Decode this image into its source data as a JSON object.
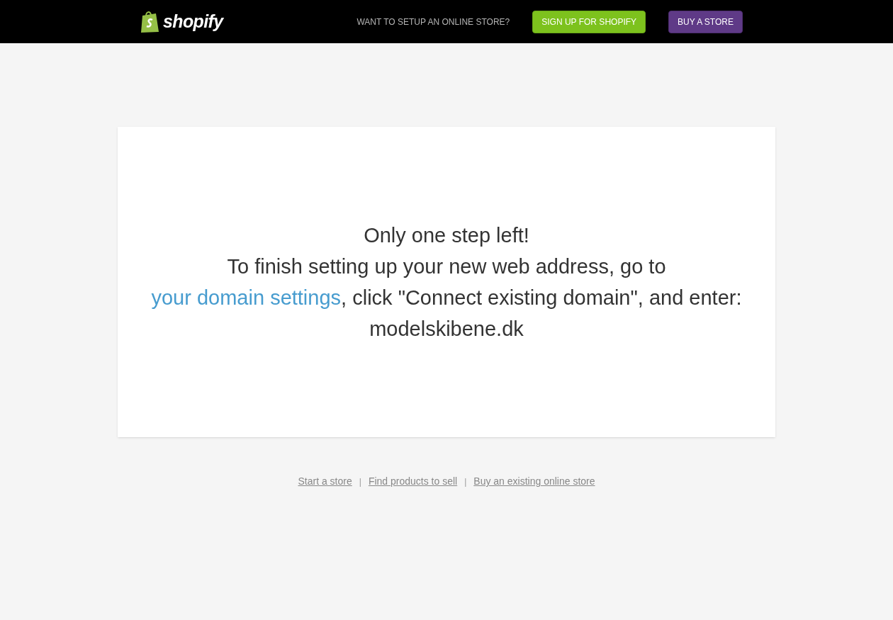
{
  "header": {
    "logo": "shopify",
    "prompt": "WANT TO SETUP AN ONLINE STORE?",
    "buttons": [
      {
        "kind": "signup",
        "label": "SIGN UP FOR SHOPIFY"
      },
      {
        "kind": "buy",
        "label": "BUY A STORE"
      }
    ]
  },
  "card": {
    "heading": "Only one step left!",
    "message_before": "To finish setting up your new web address, go to",
    "link": "your domain settings",
    "message_after": ", click \"Connect existing domain\", and enter: modelskibene.dk"
  },
  "footer": {
    "links": [
      "Start a store",
      "Find products to sell",
      "Buy an existing online store"
    ],
    "separator": "|"
  }
}
